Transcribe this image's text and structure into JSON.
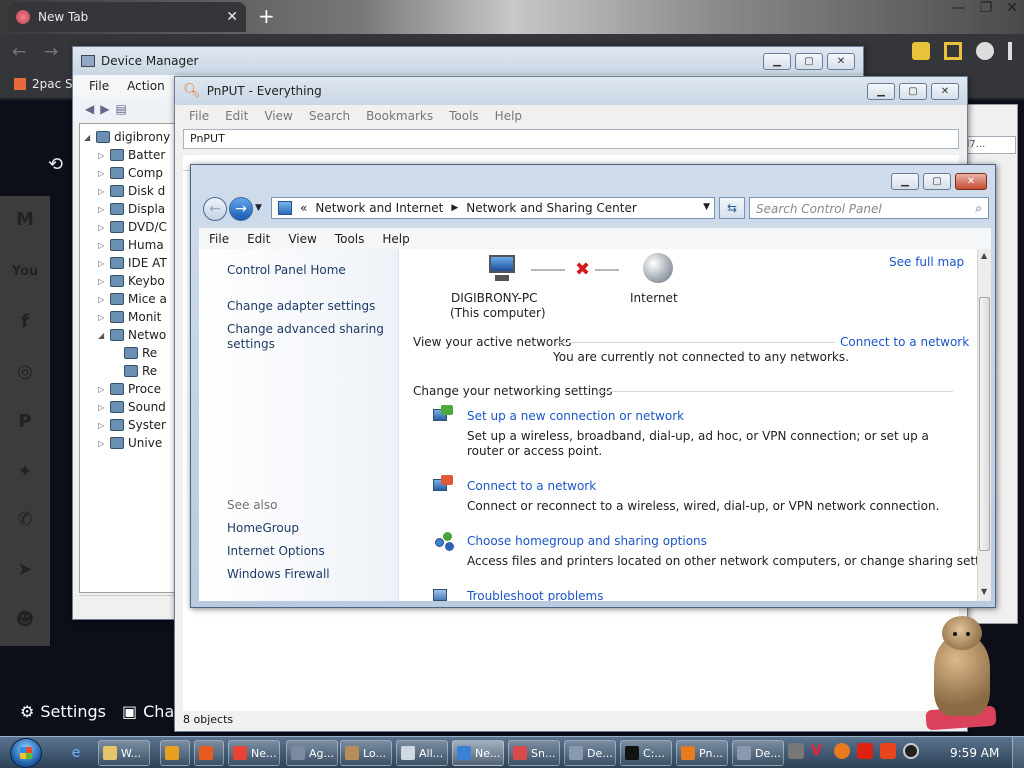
{
  "chrome": {
    "tab_title": "New Tab",
    "tab_close": "✕",
    "new_tab": "+",
    "bookmark": "2pac S",
    "settings_label": "Settings",
    "char_label": "Char",
    "win_min": "—",
    "win_max": "❐",
    "win_close": "✕"
  },
  "devmgr": {
    "title": "Device Manager",
    "menu": [
      "File",
      "Action"
    ],
    "tree": [
      {
        "label": "digibrony",
        "toggle": "◢",
        "level": 0
      },
      {
        "label": "Batter",
        "toggle": "▷",
        "level": 1
      },
      {
        "label": "Comp",
        "toggle": "▷",
        "level": 1
      },
      {
        "label": "Disk d",
        "toggle": "▷",
        "level": 1
      },
      {
        "label": "Displa",
        "toggle": "▷",
        "level": 1
      },
      {
        "label": "DVD/C",
        "toggle": "▷",
        "level": 1
      },
      {
        "label": "Huma",
        "toggle": "▷",
        "level": 1
      },
      {
        "label": "IDE AT",
        "toggle": "▷",
        "level": 1
      },
      {
        "label": "Keybo",
        "toggle": "▷",
        "level": 1
      },
      {
        "label": "Mice a",
        "toggle": "▷",
        "level": 1
      },
      {
        "label": "Monit",
        "toggle": "▷",
        "level": 1
      },
      {
        "label": "Netwo",
        "toggle": "◢",
        "level": 1
      },
      {
        "label": "Re",
        "toggle": "",
        "level": 2
      },
      {
        "label": "Re",
        "toggle": "",
        "level": 2
      },
      {
        "label": "Proce",
        "toggle": "▷",
        "level": 1
      },
      {
        "label": "Sound",
        "toggle": "▷",
        "level": 1
      },
      {
        "label": "Syster",
        "toggle": "▷",
        "level": 1
      },
      {
        "label": "Unive",
        "toggle": "▷",
        "level": 1
      }
    ]
  },
  "everything": {
    "title": "PnPUT - Everything",
    "menu": [
      "File",
      "Edit",
      "View",
      "Search",
      "Bookmarks",
      "Tools",
      "Help"
    ],
    "search_value": "PnPUT",
    "status": "8 objects"
  },
  "nsc": {
    "address_prefix": "«",
    "address_parts": [
      "Network and Internet",
      "Network and Sharing Center"
    ],
    "search_placeholder": "Search Control Panel",
    "menu": [
      "File",
      "Edit",
      "View",
      "Tools",
      "Help"
    ],
    "left_links": [
      "Control Panel Home",
      "Change adapter settings",
      "Change advanced sharing settings"
    ],
    "see_also_label": "See also",
    "see_also_links": [
      "HomeGroup",
      "Internet Options",
      "Windows Firewall"
    ],
    "see_full_map": "See full map",
    "computer_name": "DIGIBRONY-PC",
    "computer_sub": "(This computer)",
    "internet_label": "Internet",
    "active_networks_heading": "View your active networks",
    "connect_link": "Connect to a network",
    "not_connected": "You are currently not connected to any networks.",
    "change_heading": "Change your networking settings",
    "tasks": [
      {
        "title": "Set up a new connection or network",
        "desc": "Set up a wireless, broadband, dial-up, ad hoc, or VPN connection; or set up a router or access point.",
        "icon": "network-setup-icon"
      },
      {
        "title": "Connect to a network",
        "desc": "Connect or reconnect to a wireless, wired, dial-up, or VPN network connection.",
        "icon": "network-connect-icon"
      },
      {
        "title": "Choose homegroup and sharing options",
        "desc": "Access files and printers located on other network computers, or change sharing settings.",
        "icon": "homegroup-icon"
      },
      {
        "title": "Troubleshoot problems",
        "desc": "",
        "icon": "troubleshoot-icon"
      }
    ]
  },
  "taskbar": {
    "buttons": [
      {
        "label": "W...",
        "color": "#e6c46a"
      },
      {
        "label": "",
        "color": "#e8a020"
      },
      {
        "label": "",
        "color": "#e85a20"
      },
      {
        "label": "Ne...",
        "color": "#e94335"
      },
      {
        "label": "Ag...",
        "color": "#7a8aa0"
      },
      {
        "label": "Lo...",
        "color": "#b68c5a"
      },
      {
        "label": "All...",
        "color": "#cfd8e3"
      },
      {
        "label": "Ne...",
        "color": "#3c7fd6"
      },
      {
        "label": "Sn...",
        "color": "#d84a4a"
      },
      {
        "label": "De...",
        "color": "#8a9ab0"
      },
      {
        "label": "C:...",
        "color": "#111111"
      },
      {
        "label": "Pn...",
        "color": "#e87a20"
      },
      {
        "label": "De...",
        "color": "#8a9ab0"
      }
    ],
    "clock": "9:59 AM"
  }
}
